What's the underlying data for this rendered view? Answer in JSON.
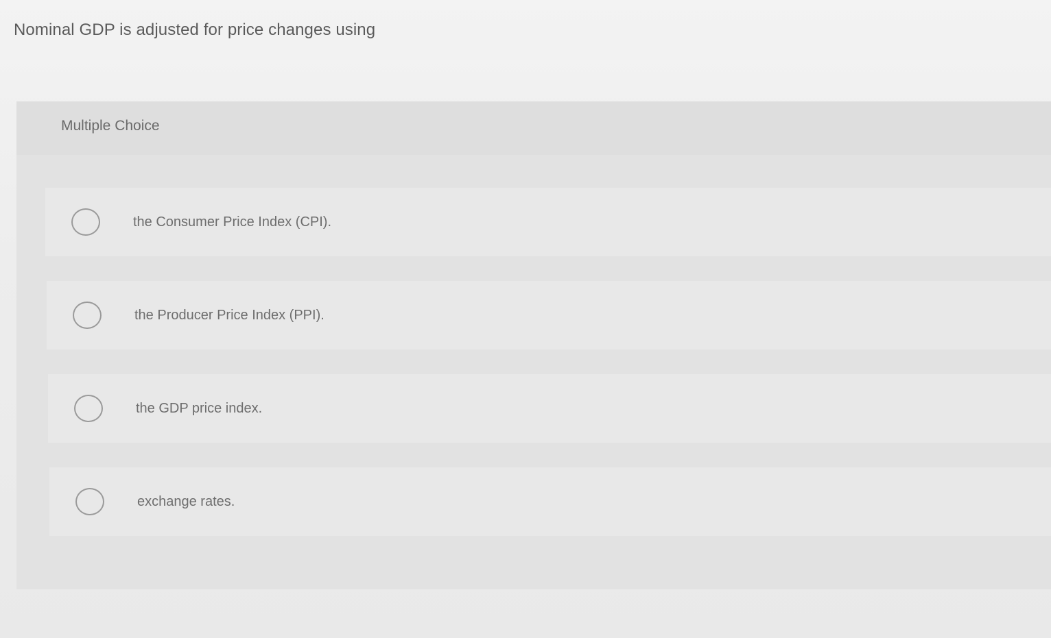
{
  "question": {
    "text": "Nominal GDP is adjusted for price changes using"
  },
  "panel": {
    "type_label": "Multiple Choice"
  },
  "options": [
    {
      "label": "the Consumer Price Index (CPI)."
    },
    {
      "label": "the Producer Price Index (PPI)."
    },
    {
      "label": "the GDP price index."
    },
    {
      "label": "exchange rates."
    }
  ]
}
